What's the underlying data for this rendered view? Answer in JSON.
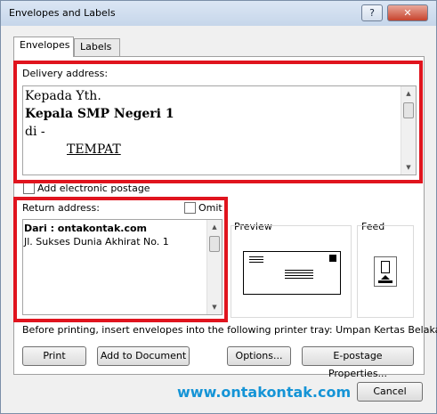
{
  "window": {
    "title": "Envelopes and Labels",
    "help_glyph": "?",
    "close_glyph": "✕"
  },
  "tabs": [
    {
      "label": "Envelopes"
    },
    {
      "label": "Labels"
    }
  ],
  "delivery": {
    "label": "Delivery address:",
    "lines": [
      "Kepada Yth.",
      "Kepala SMP Negeri 1",
      "di -",
      "TEMPAT"
    ]
  },
  "electronic_postage": {
    "label": "Add electronic postage",
    "checked": false
  },
  "return": {
    "label": "Return address:",
    "omit_label": "Omit",
    "omit_checked": false,
    "lines": [
      "Dari : ontakontak.com",
      "Jl. Sukses Dunia Akhirat No. 1"
    ]
  },
  "preview": {
    "label": "Preview"
  },
  "feed": {
    "label": "Feed"
  },
  "info_text": "Before printing, insert envelopes into the following printer tray: Umpan Kertas Belakang.",
  "buttons": {
    "print": "Print",
    "add_to_document": "Add to Document",
    "options": "Options...",
    "epostage": "E-postage Properties...",
    "cancel": "Cancel"
  },
  "watermark": "www.ontakontak.com",
  "colors": {
    "highlight_box": "#e0141e",
    "watermark": "#1594d6"
  }
}
